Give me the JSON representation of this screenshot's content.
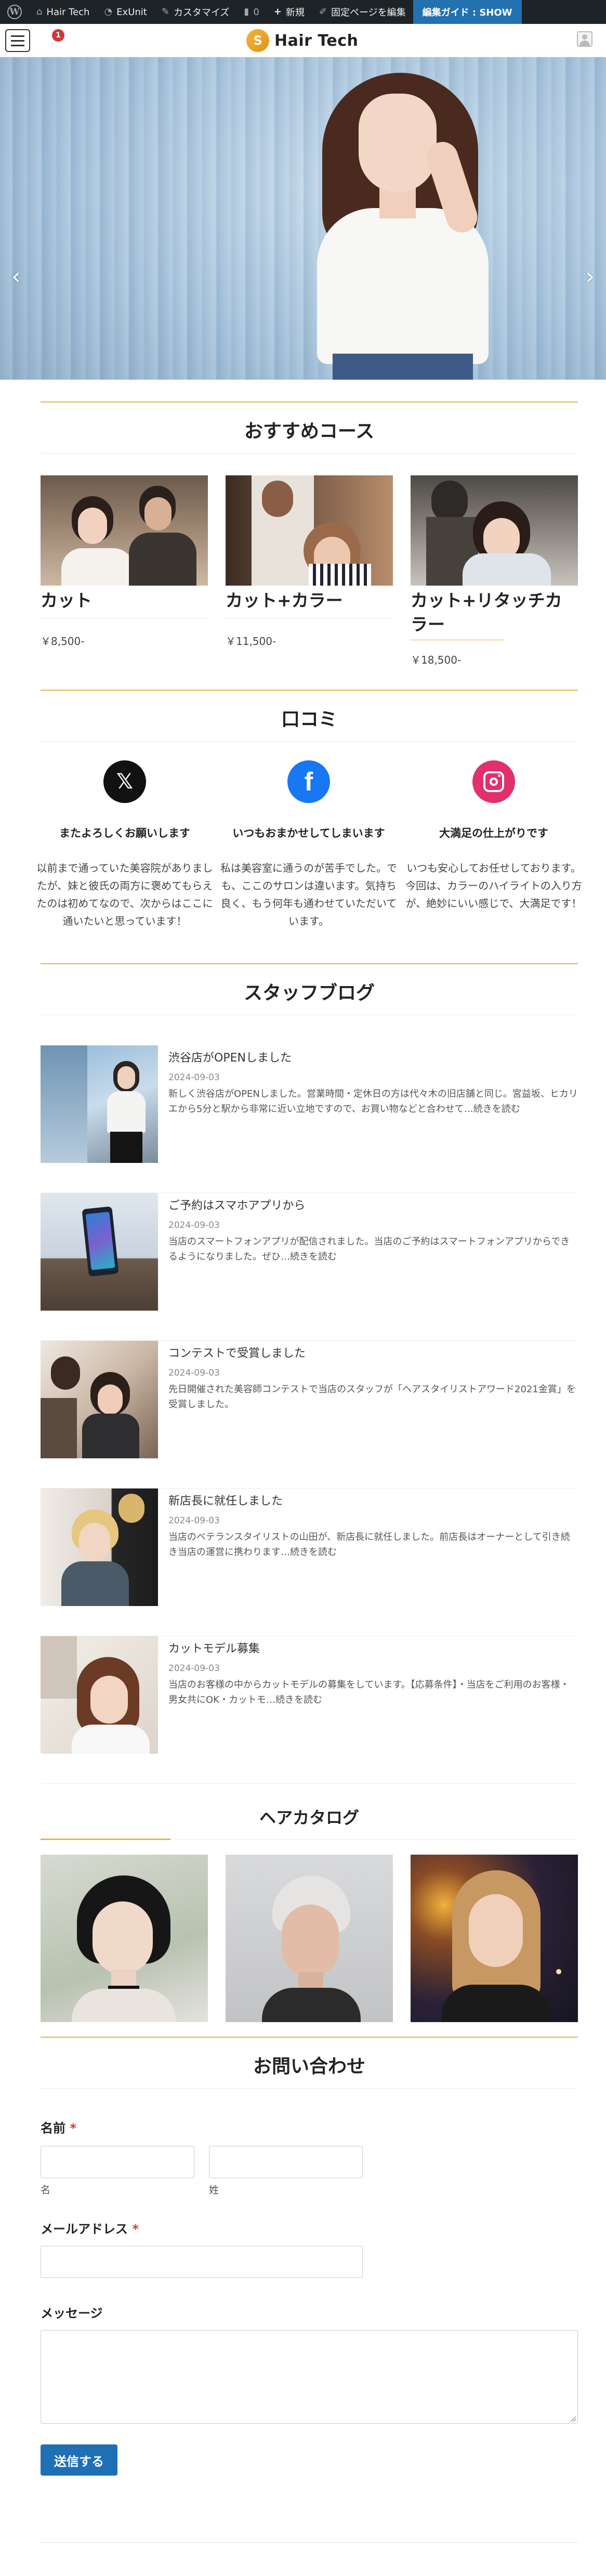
{
  "adminbar": {
    "site_name": "Hair Tech",
    "exunit": "ExUnit",
    "customize": "カスタマイズ",
    "comments_count": "0",
    "new": "新規",
    "edit_page": "固定ページを編集",
    "guide": "編集ガイド : SHOW"
  },
  "header": {
    "brand": "Hair Tech",
    "notification_count": "1"
  },
  "courses": {
    "title": "おすすめコース",
    "items": [
      {
        "name": "カット",
        "price": "￥8,500-"
      },
      {
        "name": "カット+カラー",
        "price": "￥11,500-"
      },
      {
        "name": "カット+リタッチカラー",
        "price": "￥18,500-"
      }
    ]
  },
  "reviews": {
    "title": "口コミ",
    "items": [
      {
        "title": "またよろしくお願いします",
        "text": "以前まで通っていた美容院がありましたが、妹と彼氏の両方に褒めてもらえたのは初めてなので、次からはここに通いたいと思っています！"
      },
      {
        "title": "いつもおまかせしてしまいます",
        "text": "私は美容室に通うのが苦手でした。でも、ここのサロンは違います。気持ち良く、もう何年も通わせていただいています。"
      },
      {
        "title": "大満足の仕上がりです",
        "text": "いつも安心してお任せしております。今回は、カラーのハイライトの入り方が、絶妙にいい感じで、大満足です！"
      }
    ]
  },
  "blog": {
    "title": "スタッフブログ",
    "items": [
      {
        "title": "渋谷店がOPENしました",
        "date": "2024-09-03",
        "excerpt": "新しく渋谷店がOPENしました。営業時間・定休日の方は代々木の旧店舗と同じ。宮益坂、ヒカリエから5分と駅から非常に近い立地ですので、お買い物などと合わせて…",
        "more": "続きを読む"
      },
      {
        "title": "ご予約はスマホアプリから",
        "date": "2024-09-03",
        "excerpt": "当店のスマートフォンアプリが配信されました。当店のご予約はスマートフォンアプリからできるようになりました。ぜひ…",
        "more": "続きを読む"
      },
      {
        "title": "コンテストで受賞しました",
        "date": "2024-09-03",
        "excerpt": "先日開催された美容師コンテストで当店のスタッフが「ヘアスタイリストアワード2021金賞」を受賞しました。",
        "more": ""
      },
      {
        "title": "新店長に就任しました",
        "date": "2024-09-03",
        "excerpt": "当店のベテランスタイリストの山田が、新店長に就任しました。前店長はオーナーとして引き続き当店の運営に携わります…",
        "more": "続きを読む"
      },
      {
        "title": "カットモデル募集",
        "date": "2024-09-03",
        "excerpt": "当店のお客様の中からカットモデルの募集をしています。【応募条件】・当店をご利用のお客様・男女共にOK・カットモ…",
        "more": "続きを読む"
      }
    ]
  },
  "catalog": {
    "title": "ヘアカタログ"
  },
  "contact": {
    "title": "お問い合わせ",
    "name_label": "名前",
    "first_name_sub": "名",
    "last_name_sub": "姓",
    "email_label": "メールアドレス",
    "message_label": "メッセージ",
    "required_mark": "*",
    "submit": "送信する"
  },
  "colors": {
    "accent_gold": "#e6b451",
    "admin_bar": "#1d2327",
    "guide_blue": "#2271b1",
    "submit_blue": "#1f6fb5",
    "x_black": "#111111",
    "facebook_blue": "#1877f2",
    "instagram_pink": "#e1306c"
  },
  "icons": [
    "wordpress-icon",
    "home-icon",
    "gauge-icon",
    "brush-icon",
    "comment-icon",
    "plus-icon",
    "pencil-icon",
    "menu-icon",
    "user-icon",
    "x-icon",
    "facebook-icon",
    "instagram-icon",
    "chevron-left-icon",
    "chevron-right-icon"
  ]
}
